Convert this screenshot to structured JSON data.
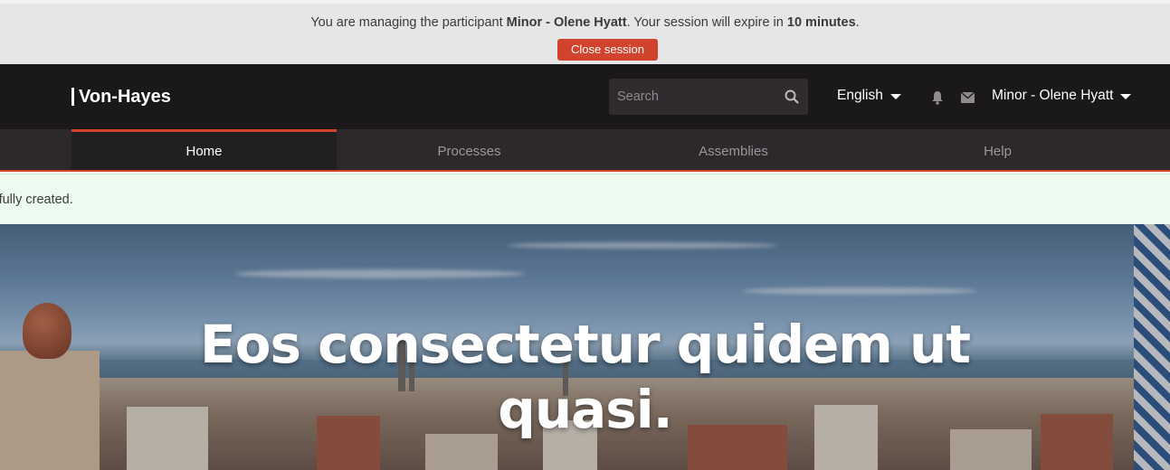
{
  "impersonation": {
    "prefix": "You are managing the participant ",
    "participant": "Minor - Olene Hyatt",
    "middle": ". Your session will expire in ",
    "expiry": "10 minutes",
    "suffix": ".",
    "close_label": "Close session",
    "close_color": "#d1432c"
  },
  "header": {
    "logo_text": "Von-Hayes",
    "search_placeholder": "Search",
    "language": "English",
    "user_name": "Minor - Olene Hyatt",
    "notifications_icon": "bell-icon",
    "conversations_icon": "envelope-icon"
  },
  "nav": {
    "items": [
      {
        "label": "Home",
        "active": true
      },
      {
        "label": "Processes",
        "active": false
      },
      {
        "label": "Assemblies",
        "active": false
      },
      {
        "label": "Help",
        "active": false
      }
    ],
    "accent": "#d1432c"
  },
  "callout": {
    "text": "essfully created."
  },
  "hero": {
    "title": "Eos consectetur quidem ut quasi."
  }
}
